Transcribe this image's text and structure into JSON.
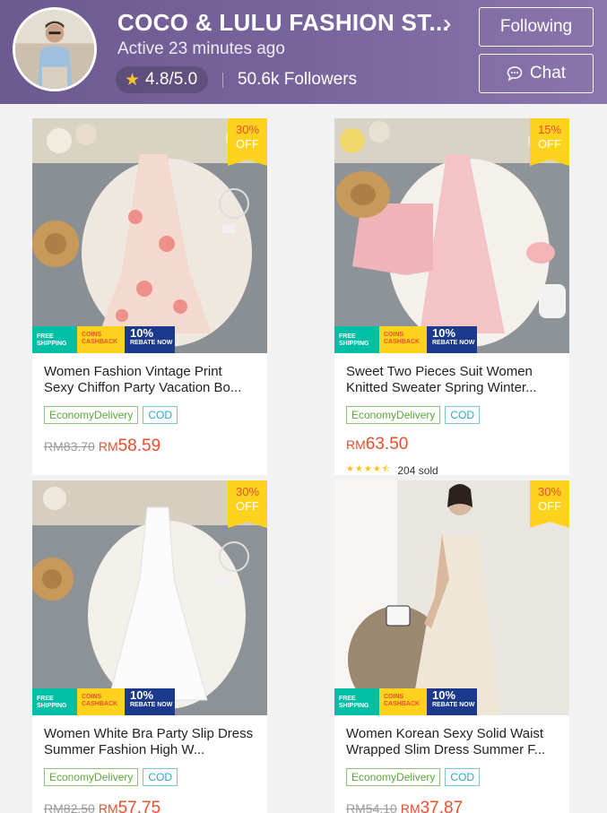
{
  "shop": {
    "name": "COCO & LULU FASHION ST...",
    "active": "Active 23 minutes ago",
    "rating": "4.8/5.0",
    "followers": "50.6k Followers",
    "follow_label": "Following",
    "chat_label": "Chat"
  },
  "colors": {
    "accent": "#ee4d2d",
    "header": "#76639b",
    "badge_yellow": "#ffd21e"
  },
  "badges": {
    "free_1": "FREE",
    "free_2": "SHIPPING",
    "coins_1": "COINS",
    "coins_2": "CASHBACK",
    "rebate_1": "10%",
    "rebate_2": "REBATE NOW",
    "discount_off": "OFF"
  },
  "products": [
    {
      "title": "Women Fashion Vintage Print Sexy Chiffon Party Vacation Bo...",
      "discount": "30%",
      "tag1": "EconomyDelivery",
      "tag2": "COD",
      "old_currency": "RM",
      "old_price": "83.70",
      "currency": "RM",
      "price": "58.59"
    },
    {
      "title": "Sweet Two Pieces Suit Women Knitted Sweater Spring Winter...",
      "discount": "15%",
      "tag1": "EconomyDelivery",
      "tag2": "COD",
      "currency": "RM",
      "price": "63.50",
      "rating_stars": 4.5,
      "sold": "204 sold"
    },
    {
      "title": "Women White Bra Party Slip Dress Summer Fashion High W...",
      "discount": "30%",
      "tag1": "EconomyDelivery",
      "tag2": "COD",
      "old_currency": "RM",
      "old_price": "82.50",
      "currency": "RM",
      "price": "57.75"
    },
    {
      "title": "Women Korean Sexy Solid Waist Wrapped Slim Dress Summer F...",
      "discount": "30%",
      "tag1": "EconomyDelivery",
      "tag2": "COD",
      "old_currency": "RM",
      "old_price": "54.10",
      "currency": "RM",
      "price": "37.87"
    }
  ]
}
